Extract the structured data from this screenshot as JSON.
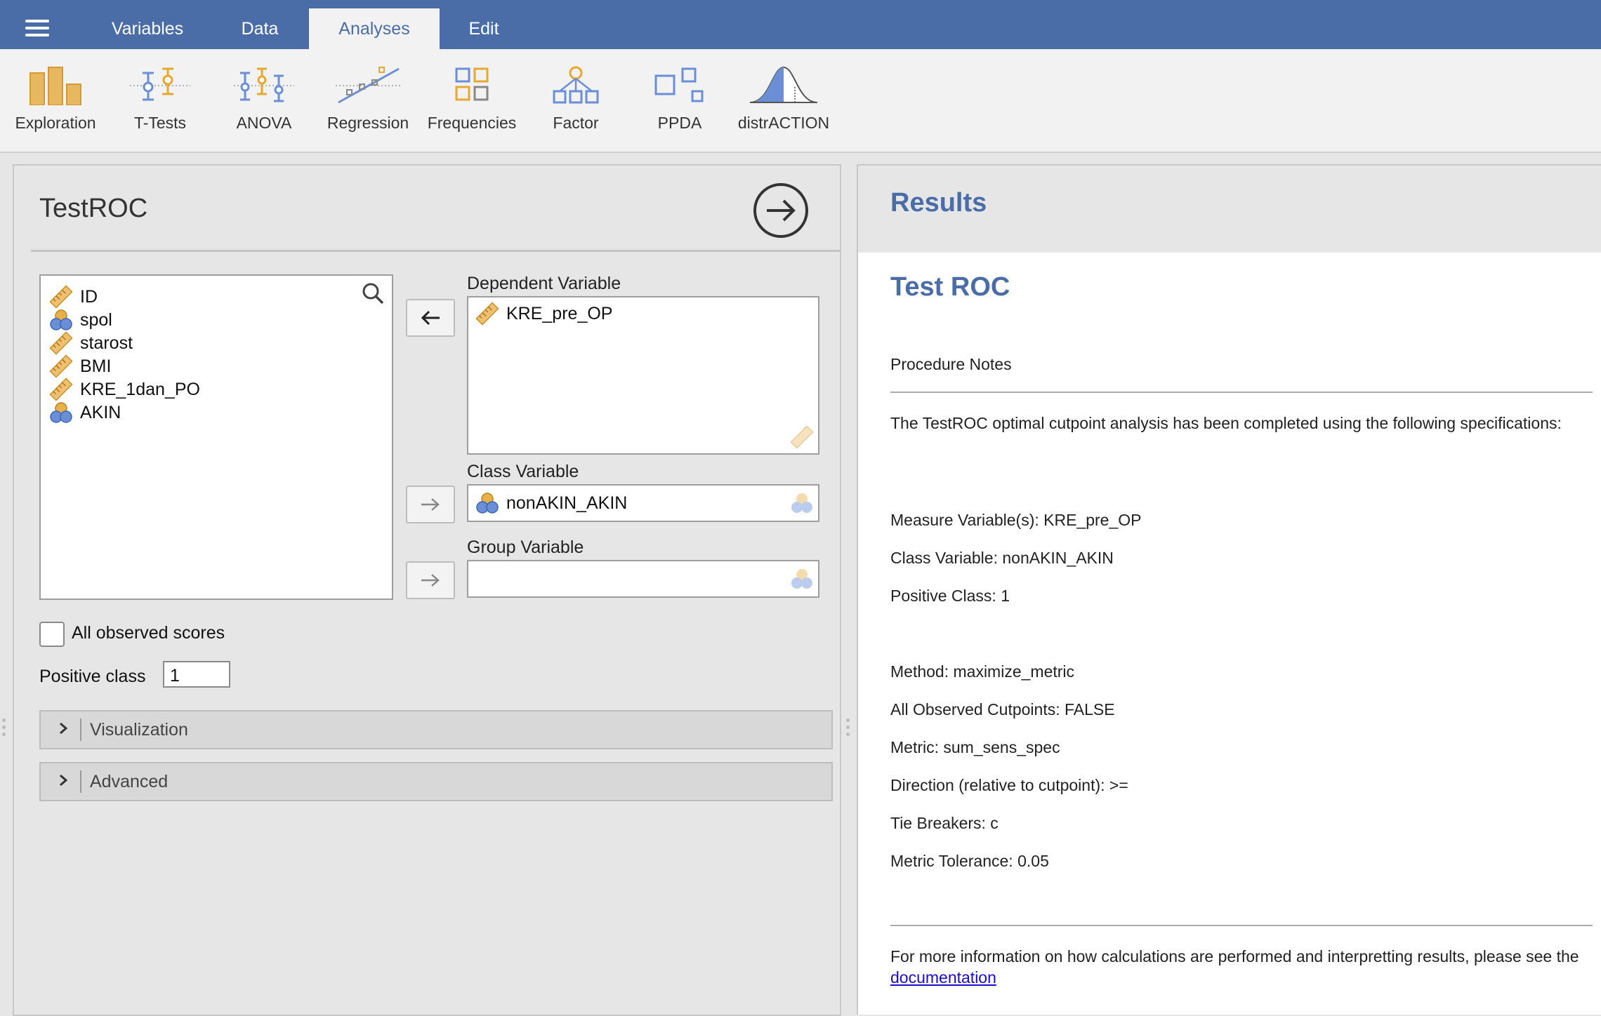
{
  "menu": {
    "tabs": [
      {
        "label": "Variables"
      },
      {
        "label": "Data"
      },
      {
        "label": "Analyses"
      },
      {
        "label": "Edit"
      }
    ],
    "active_tab": "Analyses"
  },
  "ribbon": {
    "items": [
      {
        "label": "Exploration",
        "icon": "exploration-icon"
      },
      {
        "label": "T-Tests",
        "icon": "t-tests-icon"
      },
      {
        "label": "ANOVA",
        "icon": "anova-icon"
      },
      {
        "label": "Regression",
        "icon": "regression-icon"
      },
      {
        "label": "Frequencies",
        "icon": "frequencies-icon"
      },
      {
        "label": "Factor",
        "icon": "factor-icon"
      },
      {
        "label": "PPDA",
        "icon": "ppda-icon"
      },
      {
        "label": "distrACTION",
        "icon": "distraction-icon"
      }
    ]
  },
  "options": {
    "title": "TestROC",
    "variables": [
      {
        "name": "ID",
        "type": "continuous"
      },
      {
        "name": "spol",
        "type": "nominal"
      },
      {
        "name": "starost",
        "type": "continuous"
      },
      {
        "name": "BMI",
        "type": "continuous"
      },
      {
        "name": "KRE_1dan_PO",
        "type": "continuous"
      },
      {
        "name": "AKIN",
        "type": "nominal"
      }
    ],
    "dependent": {
      "label": "Dependent Variable",
      "value": "KRE_pre_OP"
    },
    "class_var": {
      "label": "Class Variable",
      "value": "nonAKIN_AKIN"
    },
    "group_var": {
      "label": "Group Variable",
      "value": ""
    },
    "all_observed": {
      "label": "All observed scores",
      "checked": false
    },
    "positive_class": {
      "label": "Positive class",
      "value": "1"
    },
    "sections": [
      {
        "label": "Visualization"
      },
      {
        "label": "Advanced"
      }
    ]
  },
  "results": {
    "header": "Results",
    "title": "Test ROC",
    "notes_heading": "Procedure Notes",
    "intro": "The TestROC optimal cutpoint analysis has been completed using the following specifications:",
    "lines": [
      "Measure Variable(s): KRE_pre_OP",
      "Class Variable: nonAKIN_AKIN",
      "Positive Class: 1",
      "Method: maximize_metric",
      "All Observed Cutpoints: FALSE",
      "Metric: sum_sens_spec",
      "Direction (relative to cutpoint): >=",
      "Tie Breakers: c",
      "Metric Tolerance: 0.05"
    ],
    "footer_text": "For more information on how calculations are performed and interpretting results, please see the",
    "footer_link": "documentation"
  },
  "colors": {
    "brand": "#4a6da7",
    "continuous": "#e8b048",
    "nominal_orange": "#e8b048",
    "nominal_blue": "#6b8fd6",
    "link": "#1a0dcc"
  }
}
